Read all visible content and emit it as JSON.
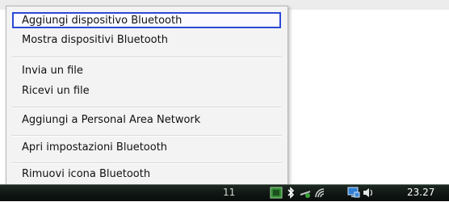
{
  "menu": {
    "items": [
      {
        "label": "Aggiungi dispositivo Bluetooth"
      },
      {
        "label": "Mostra dispositivi Bluetooth"
      },
      {
        "label": "Invia un file"
      },
      {
        "label": "Ricevi un file"
      },
      {
        "label": "Aggiungi a Personal Area Network"
      },
      {
        "label": "Apri impostazioni Bluetooth"
      },
      {
        "label": "Rimuovi icona Bluetooth"
      }
    ]
  },
  "taskbar": {
    "partial_text": "11",
    "clock": "23.27",
    "tray_icons": [
      "app-icon",
      "bluetooth-icon",
      "network-icon",
      "wifi-signal-icon",
      "monitor-icon",
      "volume-icon"
    ]
  },
  "colors": {
    "selection_border": "#2c49d6",
    "menu_background": "#f3f3f3",
    "taskbar": "#0f1512"
  }
}
